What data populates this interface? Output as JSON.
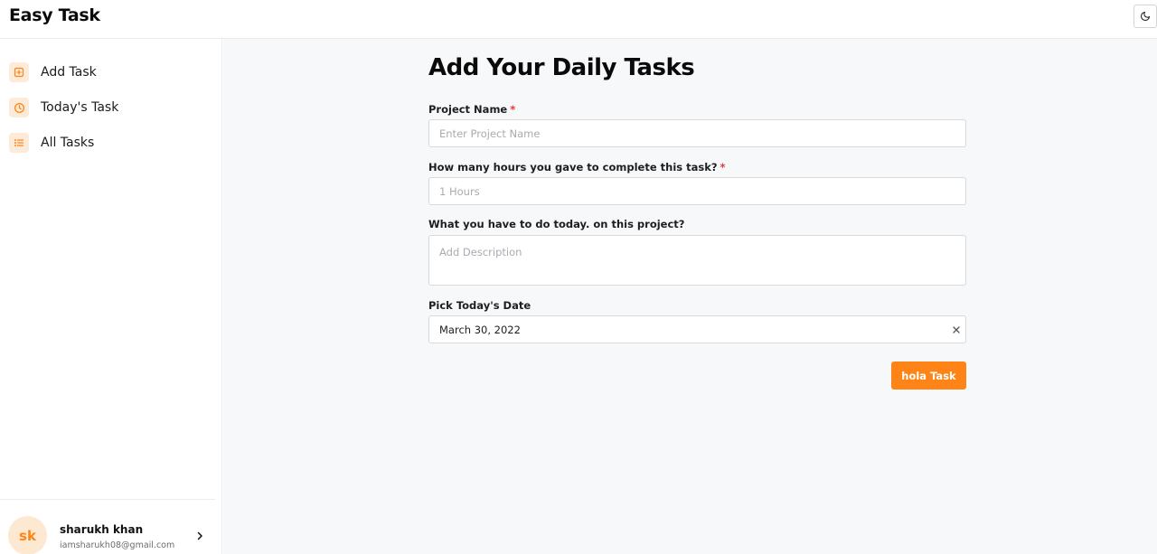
{
  "app": {
    "title": "Easy Task",
    "accent": "#ff8418"
  },
  "header": {
    "theme_toggle_icon": "moon-icon"
  },
  "sidebar": {
    "items": [
      {
        "label": "Add Task",
        "icon": "plus-square-icon"
      },
      {
        "label": "Today's Task",
        "icon": "clock-icon"
      },
      {
        "label": "All Tasks",
        "icon": "list-icon"
      }
    ],
    "user": {
      "initials": "sk",
      "name": "sharukh khan",
      "email": "iamsharukh08@gmail.com"
    }
  },
  "form": {
    "title": "Add Your Daily Tasks",
    "required_mark": "*",
    "project_name": {
      "label": "Project Name",
      "placeholder": "Enter Project Name",
      "value": ""
    },
    "hours": {
      "label": "How many hours you gave to complete this task?",
      "placeholder": "1 Hours",
      "value": ""
    },
    "description": {
      "label": "What you have to do today. on this project?",
      "placeholder": "Add Description",
      "value": ""
    },
    "date": {
      "label": "Pick Today's Date",
      "value": "March 30, 2022"
    },
    "submit_label": "hola Task"
  }
}
